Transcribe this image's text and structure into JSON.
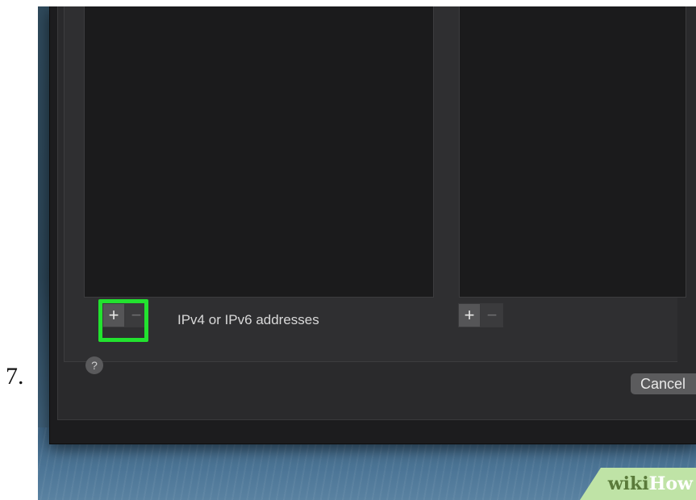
{
  "step": {
    "number": "7."
  },
  "left_list": {
    "add_symbol": "+",
    "remove_symbol": "−",
    "label": "IPv4 or IPv6 addresses"
  },
  "right_list": {
    "add_symbol": "+",
    "remove_symbol": "−"
  },
  "footer": {
    "help_symbol": "?",
    "cancel_label": "Cancel"
  },
  "watermark": {
    "part1": "wiki",
    "part2": "How"
  },
  "colors": {
    "highlight": "#22e22f",
    "panel_bg": "#1b1b1c",
    "sheet_bg": "#2a2a2c"
  },
  "icons": {
    "add": "plus-icon",
    "remove": "minus-icon",
    "help": "question-mark-icon"
  }
}
